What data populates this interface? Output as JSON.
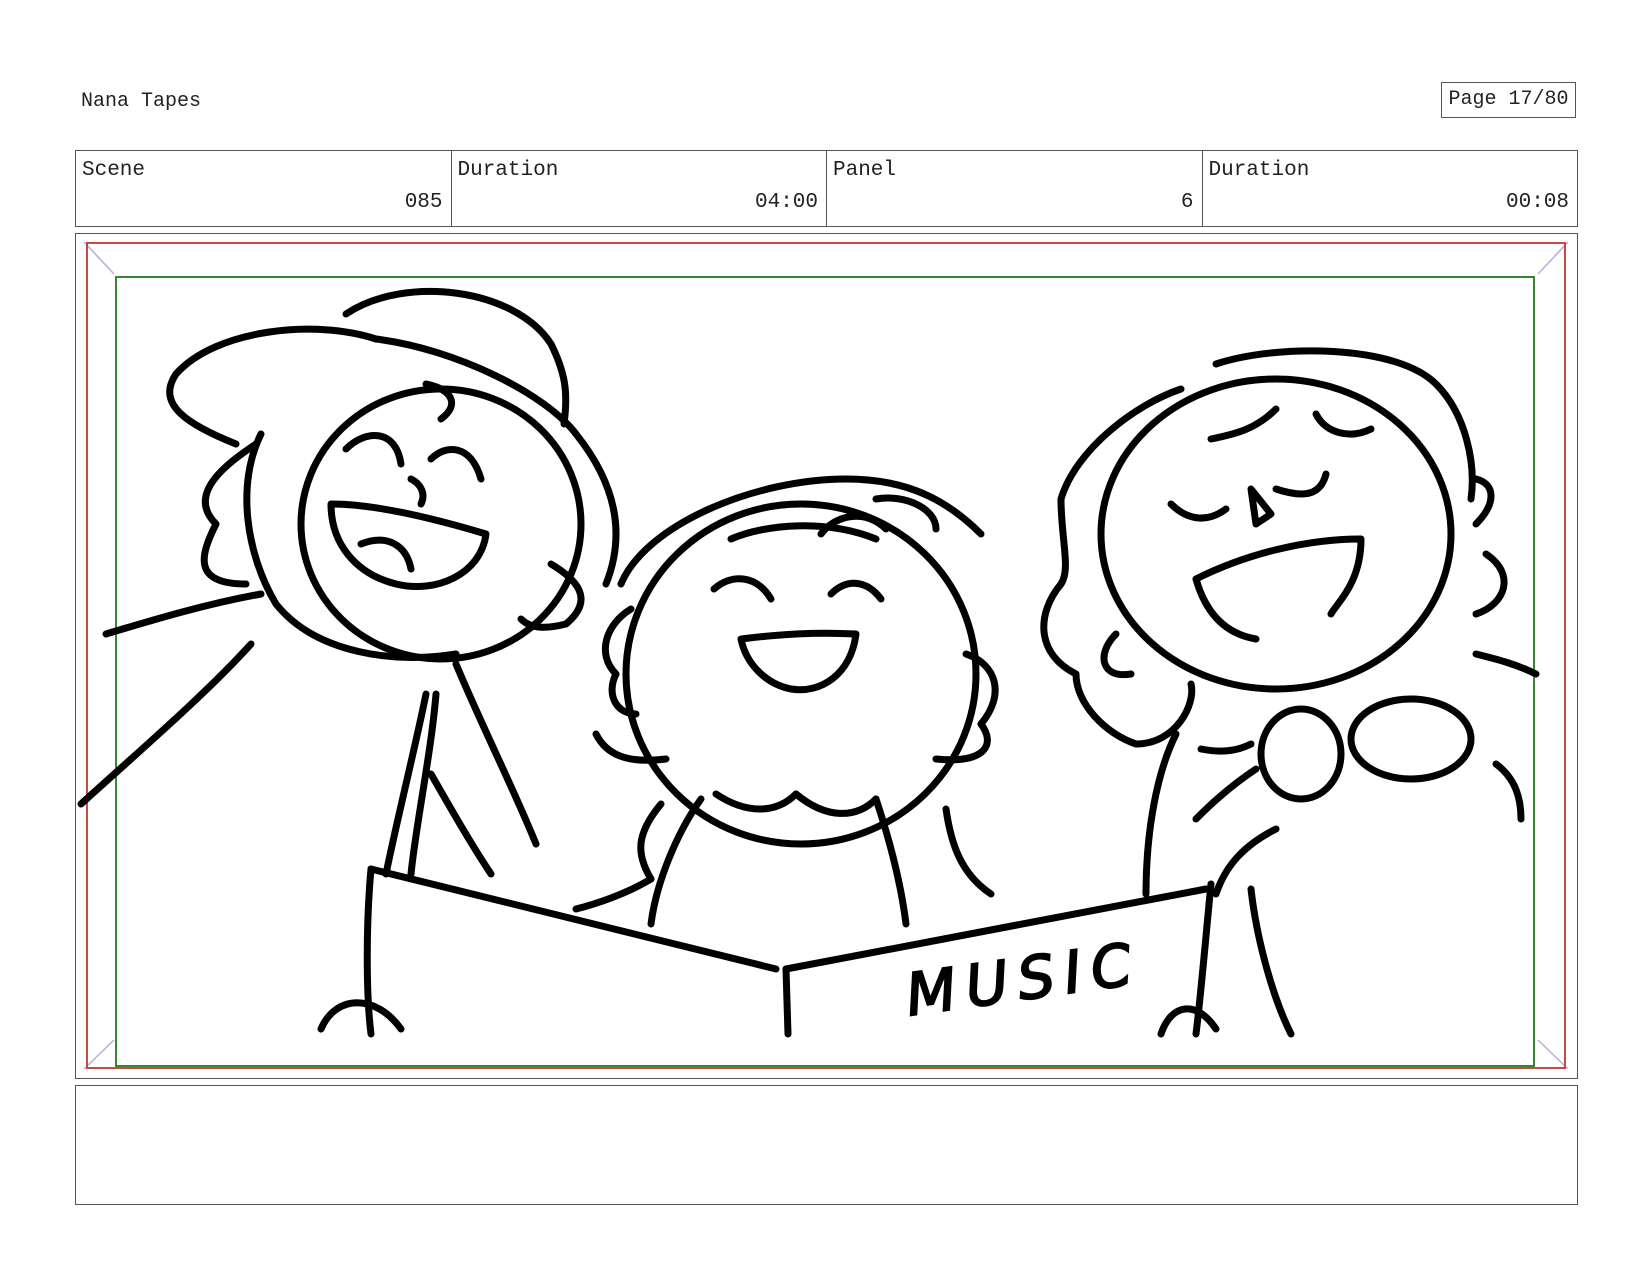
{
  "header": {
    "project_title": "Nana Tapes",
    "page_label": "Page 17/80"
  },
  "info": {
    "scene_label": "Scene",
    "scene_value": "085",
    "scene_duration_label": "Duration",
    "scene_duration_value": "04:00",
    "panel_label": "Panel",
    "panel_value": "6",
    "panel_duration_label": "Duration",
    "panel_duration_value": "00:08"
  },
  "panel": {
    "book_text": "MUSIC",
    "safe_frame_color": "#1e7a1e",
    "action_frame_color": "#c0392b",
    "ink_color": "#000000"
  },
  "notes": {
    "text": ""
  }
}
